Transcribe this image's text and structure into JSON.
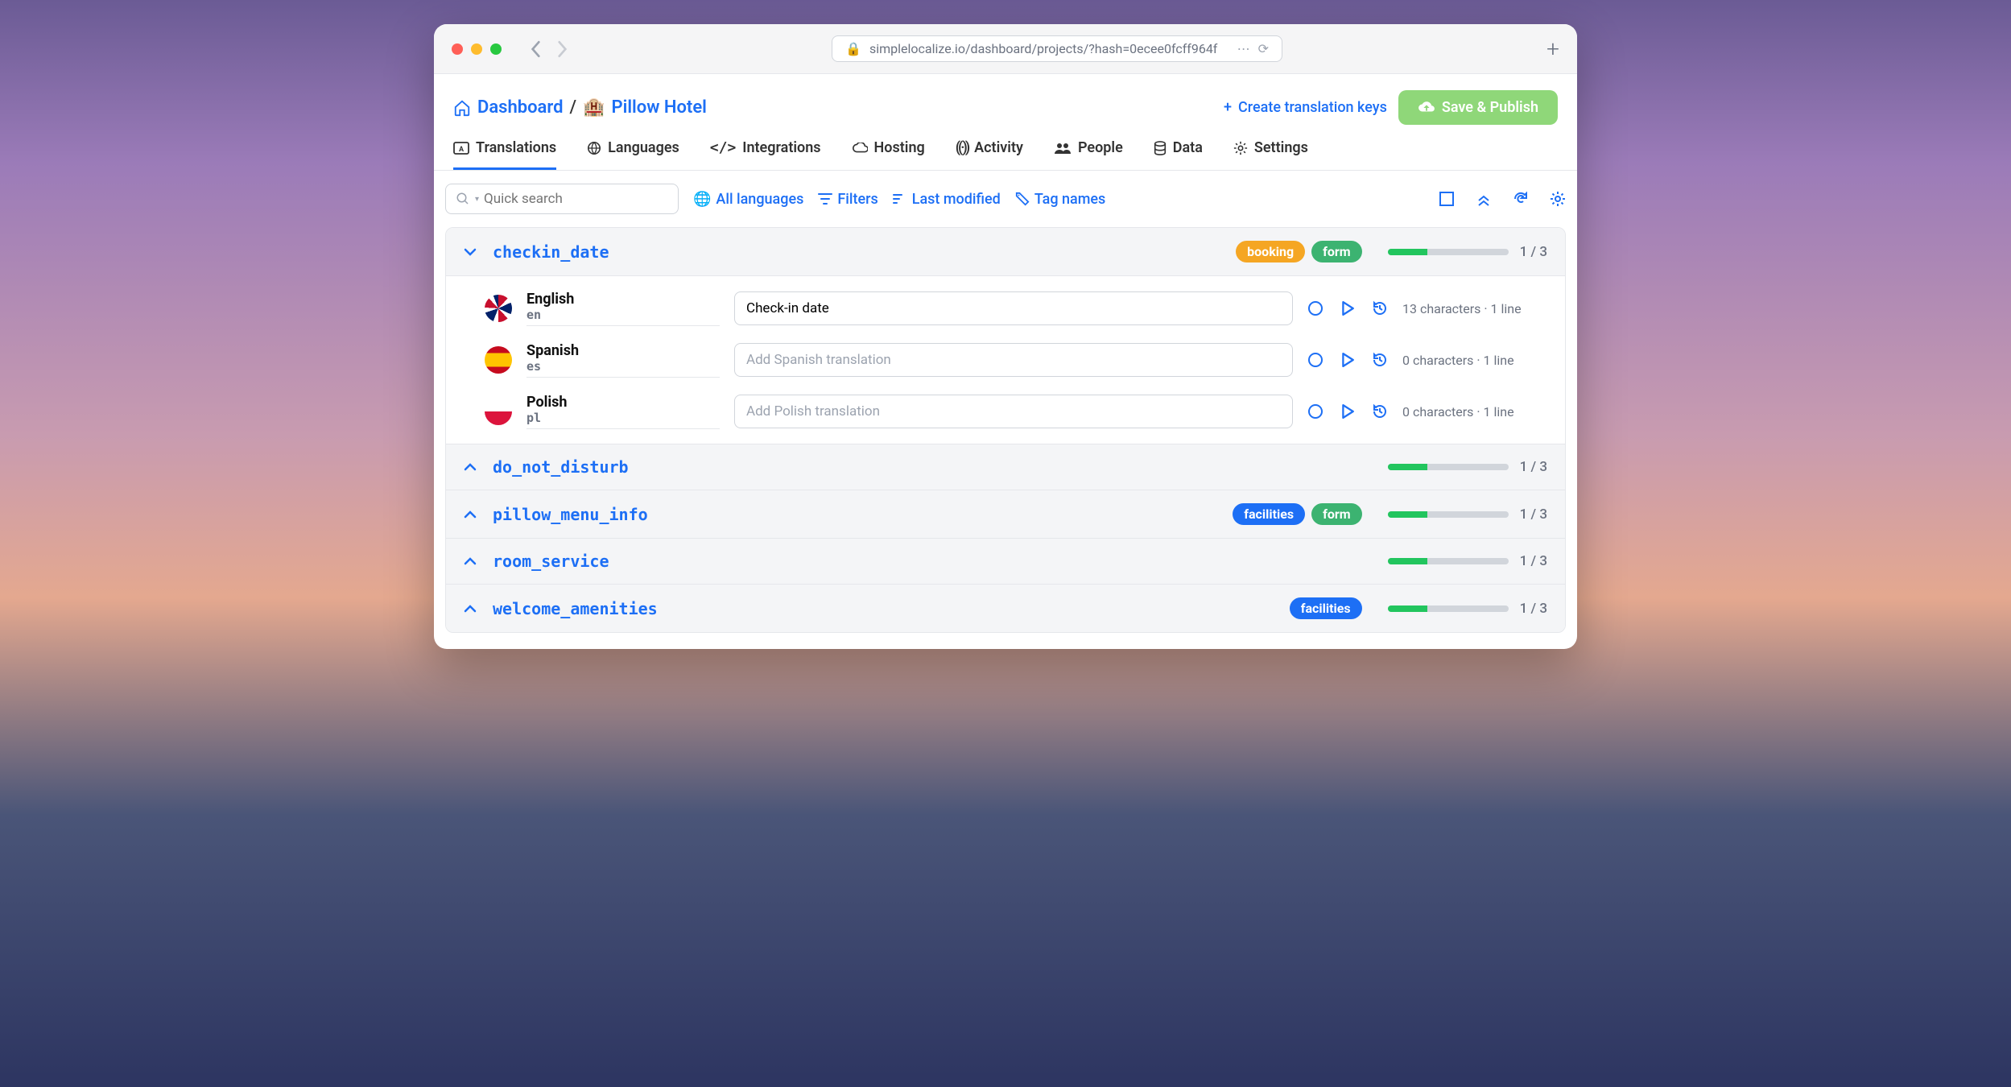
{
  "browser": {
    "url": "simplelocalize.io/dashboard/projects/?hash=0ecee0fcff964f"
  },
  "breadcrumb": {
    "dashboard": "Dashboard",
    "sep": "/",
    "project_emoji": "🏨",
    "project": "Pillow Hotel"
  },
  "actions": {
    "create": "Create translation keys",
    "save": "Save & Publish"
  },
  "tabs": [
    {
      "label": "Translations",
      "active": true
    },
    {
      "label": "Languages"
    },
    {
      "label": "Integrations"
    },
    {
      "label": "Hosting"
    },
    {
      "label": "Activity"
    },
    {
      "label": "People"
    },
    {
      "label": "Data"
    },
    {
      "label": "Settings"
    }
  ],
  "toolbar": {
    "search_placeholder": "Quick search",
    "all_languages": "All languages",
    "filters": "Filters",
    "last_modified": "Last modified",
    "tag_names": "Tag names"
  },
  "keys": [
    {
      "name": "checkin_date",
      "expanded": true,
      "tags": [
        {
          "text": "booking",
          "color": "orange"
        },
        {
          "text": "form",
          "color": "green"
        }
      ],
      "progress": "1 / 3",
      "langs": [
        {
          "name": "English",
          "code": "en",
          "flag": "uk",
          "value": "Check-in date",
          "placeholder": "",
          "meta": "13 characters · 1 line"
        },
        {
          "name": "Spanish",
          "code": "es",
          "flag": "es",
          "value": "",
          "placeholder": "Add Spanish translation",
          "meta": "0 characters · 1 line"
        },
        {
          "name": "Polish",
          "code": "pl",
          "flag": "pl",
          "value": "",
          "placeholder": "Add Polish translation",
          "meta": "0 characters · 1 line"
        }
      ]
    },
    {
      "name": "do_not_disturb",
      "expanded": false,
      "tags": [],
      "progress": "1 / 3"
    },
    {
      "name": "pillow_menu_info",
      "expanded": false,
      "tags": [
        {
          "text": "facilities",
          "color": "blue"
        },
        {
          "text": "form",
          "color": "green"
        }
      ],
      "progress": "1 / 3"
    },
    {
      "name": "room_service",
      "expanded": false,
      "tags": [],
      "progress": "1 / 3"
    },
    {
      "name": "welcome_amenities",
      "expanded": false,
      "tags": [
        {
          "text": "facilities",
          "color": "blue"
        }
      ],
      "progress": "1 / 3"
    }
  ]
}
